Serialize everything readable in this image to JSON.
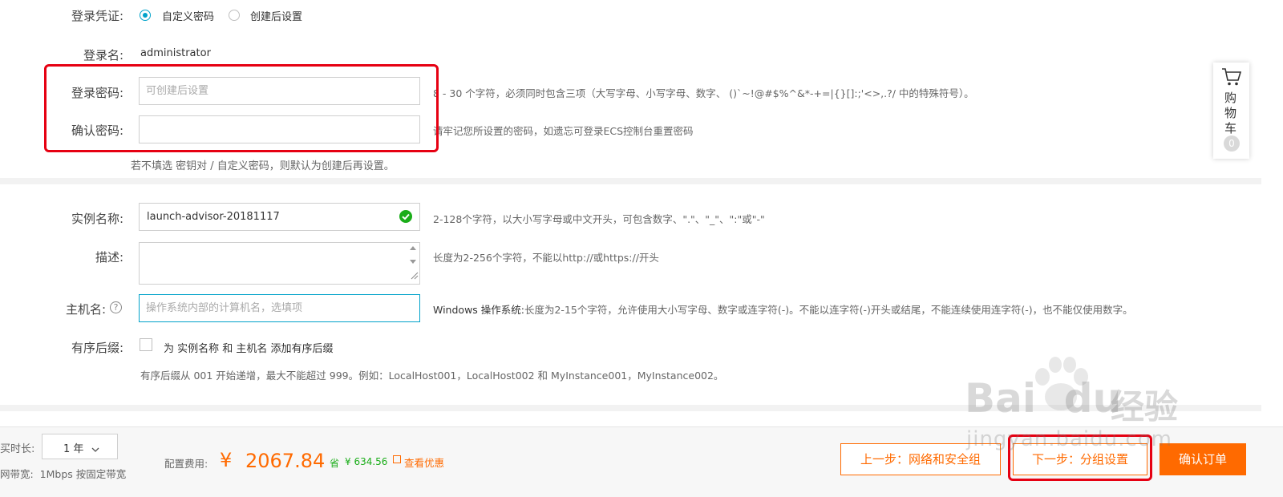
{
  "credential": {
    "label": "登录凭证:",
    "options": [
      {
        "label": "自定义密码",
        "selected": true
      },
      {
        "label": "创建后设置",
        "selected": false
      }
    ]
  },
  "login_name": {
    "label": "登录名:",
    "value": "administrator"
  },
  "password": {
    "label": "登录密码:",
    "placeholder": "可创建后设置",
    "hint": "8 - 30 个字符，必须同时包含三项（大写字母、小写字母、数字、 ()`~!@#$%^&*-+=|{}[]:;'<>,.?/ 中的特殊符号）。"
  },
  "confirm_password": {
    "label": "确认密码:",
    "placeholder": "",
    "hint": "请牢记您所设置的密码，如遗忘可登录ECS控制台重置密码"
  },
  "default_note": "若不填选 密钥对 / 自定义密码，则默认为创建后再设置。",
  "instance_name": {
    "label": "实例名称:",
    "value": "launch-advisor-20181117",
    "hint": "2-128个字符，以大小写字母或中文开头，可包含数字、\".\"、\"_\"、\":\"或\"-\""
  },
  "description": {
    "label": "描述:",
    "value": "",
    "hint": "长度为2-256个字符，不能以http://或https://开头"
  },
  "hostname": {
    "label": "主机名:",
    "placeholder": "操作系统内部的计算机名，选填项",
    "hint_bold": "Windows 操作系统:",
    "hint": "长度为2-15个字符，允许使用大小写字母、数字或连字符(-)。不能以连字符(-)开头或结尾，不能连续使用连字符(-)，也不能仅使用数字。"
  },
  "ordered_suffix": {
    "label": "有序后缀:",
    "checkbox_label": "为 实例名称 和 主机名 添加有序后缀",
    "checked": false,
    "note": "有序后缀从 001 开始递增，最大不能超过 999。例如：LocalHost001，LocalHost002 和 MyInstance001，MyInstance002。"
  },
  "cart": {
    "line1": "购",
    "line2": "物",
    "line3": "车",
    "count": "0"
  },
  "footer": {
    "duration_label": "买时长:",
    "duration_value": "1 年",
    "bandwidth": "网带宽:  1Mbps 按固定带宽",
    "fee_label": "配置费用:",
    "currency": "¥",
    "price": "2067.84",
    "save_label": "省",
    "save_amount": "¥ 634.56",
    "discount_link": "查看优惠",
    "prev_button": "上一步：网络和安全组",
    "next_button": "下一步：分组设置",
    "confirm_button": "确认订单"
  },
  "watermark": {
    "brand": "Bai  du",
    "brand_cn": "经验",
    "url": "jingyan.baidu.com"
  },
  "colors": {
    "accent": "#ff6a00",
    "link": "#00a2ca",
    "highlight": "#e60012",
    "success": "#1aad19"
  }
}
